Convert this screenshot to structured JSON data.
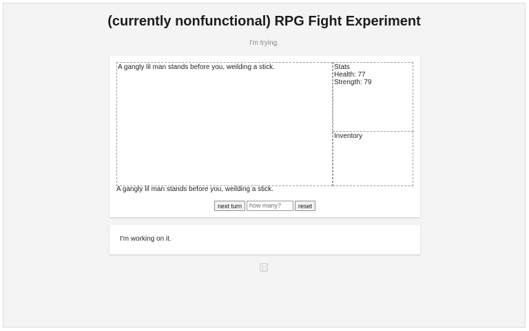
{
  "header": {
    "title": "(currently nonfunctional) RPG Fight Experiment",
    "subtitle": "I'm trying."
  },
  "game": {
    "log_text": "A gangly lil man stands before you, weilding a stick.",
    "stats": {
      "heading": "Stats",
      "health_line": "Health: 77",
      "strength_line": "Strength: 79"
    },
    "inventory": {
      "heading": "Inventory"
    },
    "status_line": "A gangly lil man stands before you, weilding a stick.",
    "controls": {
      "next_turn_label": "next turn",
      "count_placeholder": "how many?",
      "count_value": "",
      "reset_label": "reset"
    }
  },
  "message": {
    "text": "I'm working on it."
  },
  "icons": {
    "footer": "dice-icon"
  }
}
